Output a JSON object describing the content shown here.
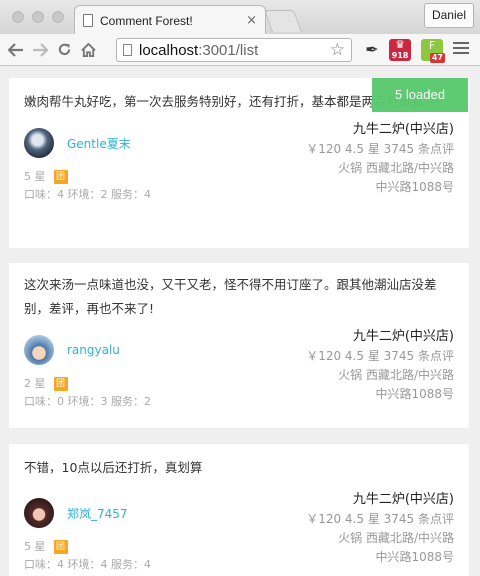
{
  "browser": {
    "tab_title": "Comment Forest!",
    "tab_close": "×",
    "profile_name": "Daniel",
    "url_host": "localhost",
    "url_path": ":3001/list",
    "ext_red_badge": "918",
    "ext_green_badge": "47"
  },
  "toast": {
    "text": "5 loaded",
    "color": "#59c96d"
  },
  "comments": [
    {
      "text": "嫩肉帮牛丸好吃，第一次去服务特别好，还有打折，基本都是两百打折算~",
      "user": "Gentle夏末",
      "stars": "5 星",
      "tuan": "团",
      "scores": "口味：4  环境：2  服务：4",
      "shop_name": "九牛二炉(中兴店)",
      "shop_stats": "￥120  4.5 星  3745 条点评",
      "shop_category": "火锅  西藏北路/中兴路",
      "shop_address": "中兴路1088号"
    },
    {
      "text": "这次来汤一点味道也没，又干又老，怪不得不用订座了。跟其他潮汕店没差别，差评，再也不来了!",
      "user": "rangyalu",
      "stars": "2 星",
      "tuan": "团",
      "scores": "口味：0  环境：3  服务：2",
      "shop_name": "九牛二炉(中兴店)",
      "shop_stats": "￥120  4.5 星  3745 条点评",
      "shop_category": "火锅  西藏北路/中兴路",
      "shop_address": "中兴路1088号"
    },
    {
      "text": "不错，10点以后还打折，真划算",
      "user": "郑岚_7457",
      "stars": "5 星",
      "tuan": "团",
      "scores": "口味：4  环境：4  服务：4",
      "shop_name": "九牛二炉(中兴店)",
      "shop_stats": "￥120  4.5 星  3745 条点评",
      "shop_category": "火锅  西藏北路/中兴路",
      "shop_address": "中兴路1088号"
    }
  ]
}
